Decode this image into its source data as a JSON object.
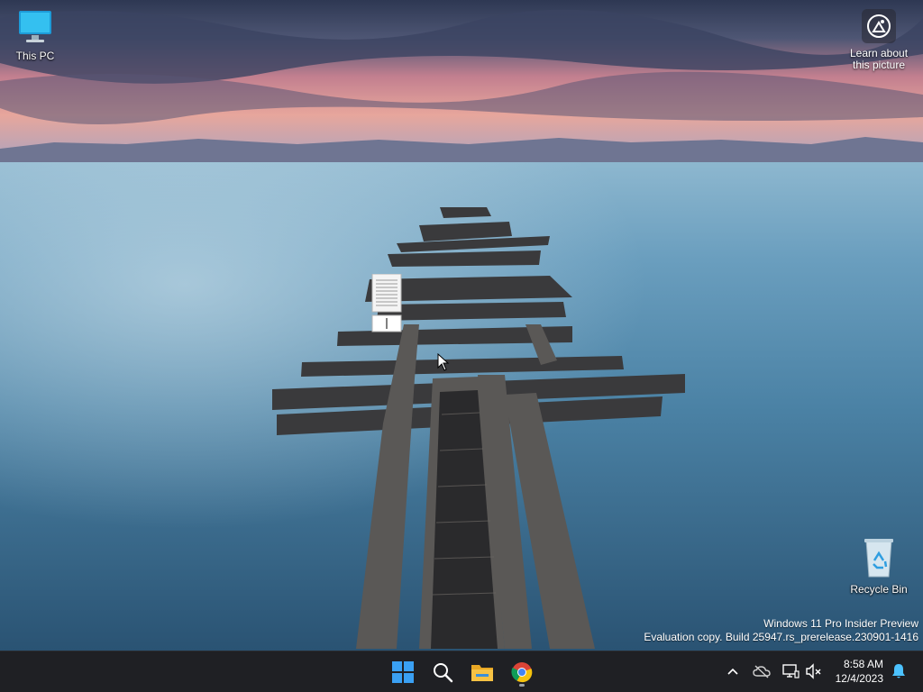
{
  "desktop": {
    "icons": {
      "this_pc": "This PC",
      "recycle_bin": "Recycle Bin"
    },
    "learn_about_picture": "Learn about this picture",
    "watermark": {
      "line1": "Windows 11 Pro Insider Preview",
      "line2": "Evaluation copy. Build 25947.rs_prerelease.230901-1416"
    }
  },
  "taskbar": {
    "apps": [
      {
        "name": "start",
        "icon": "windows-logo-icon"
      },
      {
        "name": "search",
        "icon": "search-icon"
      },
      {
        "name": "file-explorer",
        "icon": "folder-icon"
      },
      {
        "name": "chrome",
        "icon": "chrome-icon",
        "running": true
      }
    ],
    "tray": {
      "icons": [
        "chevron-up-icon",
        "cloud-offline-icon",
        "network-icon",
        "volume-muted-icon",
        "notification-bell-icon"
      ]
    },
    "clock": {
      "time": "8:58 AM",
      "date": "12/4/2023"
    }
  },
  "colors": {
    "taskbar_bg": "#1f2024",
    "windows_blue": "#3aa0f3",
    "folder_yellow": "#f6c244",
    "bell_blue": "#4cc2ff"
  }
}
